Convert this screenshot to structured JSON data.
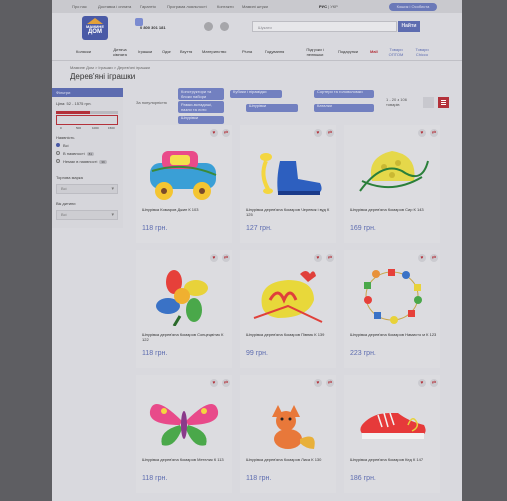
{
  "topbar": {
    "links": [
      "Про нас",
      "Доставка і оплата",
      "Гарантія",
      "Програма лояльності",
      "Контакти",
      "Мамині штуки"
    ],
    "lang_active": "РУС",
    "lang_other": "УКР",
    "cabinet": "Кошик і Особиста"
  },
  "header": {
    "logo_top": "МАМИНЕ",
    "logo_bottom": "ДОМ",
    "phone": "0 800 301 181",
    "search_placeholder": "Шукати",
    "search_button": "Найти"
  },
  "nav": {
    "items": [
      "Коляски",
      "Дитяча кімната",
      "Іграшки",
      "Одяг",
      "Взуття",
      "Материнство",
      "Річна",
      "Годування",
      "Підгузки і пелюшки",
      "Подарунки",
      "Mall",
      "Товари ОПТОМ",
      "Товари Chicco"
    ]
  },
  "breadcrumb": "Мамине Дом  >  Іграшки  >  Дерев'яні іграшки",
  "page_title": "Дерев'яні іграшки",
  "sidebar": {
    "filter_header": "Фільтри",
    "price_label": "Ціна: 52 - 1575 грн.",
    "price_min": 52,
    "price_max": 1575,
    "price_fill": 0.55,
    "ticks": [
      "0",
      "500",
      "1000",
      "1500"
    ],
    "availability_label": "Наявність",
    "options": [
      {
        "label": "Всі",
        "on": true
      },
      {
        "label": "В наявності",
        "count": "81"
      },
      {
        "label": "Немає в наявності",
        "count": "39"
      }
    ],
    "brand_label": "Торгова марка",
    "brand_value": "Всі",
    "age_label": "Вік дитини",
    "age_value": "Всі"
  },
  "sort": {
    "label": "За популярністю"
  },
  "tags": [
    "Конструктори та блоки набори",
    "Кубики і пірамідки",
    "Сортери та головоломки",
    "Рамки-вкладиші, пазли та лото",
    "Шнурівки",
    "Каталки",
    "Шнурівки"
  ],
  "count_text": "1 - 20 з 106 товарів",
  "products": [
    {
      "name": "Шнурівка Комаров Джип К 103",
      "price": "118 грн."
    },
    {
      "name": "Шнурівка дерев'яна Комаров Черевик і вуд К 125",
      "price": "127 грн."
    },
    {
      "name": "Шнурівка дерев'яна Комаров Сир К 143",
      "price": "169 грн."
    },
    {
      "name": "Шнурівка дерев'яна Комаров Сонцецвітик К 122",
      "price": "118 грн."
    },
    {
      "name": "Шнурівка дерев'яна Комаров Півник К 139",
      "price": "99 грн."
    },
    {
      "name": "Шнурівка дерев'яна Комаров Намисто м К 123",
      "price": "223 грн."
    },
    {
      "name": "Шнурівка дерев'яна Комаров Метелик К 113",
      "price": "118 грн."
    },
    {
      "name": "Шнурівка дерев'яна Комаров Лиса К 130",
      "price": "118 грн."
    },
    {
      "name": "Шнурівка дерев'яна Комаров Кед К 147",
      "price": "186 грн."
    }
  ],
  "colors": {
    "accent": "#5d6cb0",
    "brand_red": "#b3313a",
    "overlay": "#5e5e62"
  }
}
